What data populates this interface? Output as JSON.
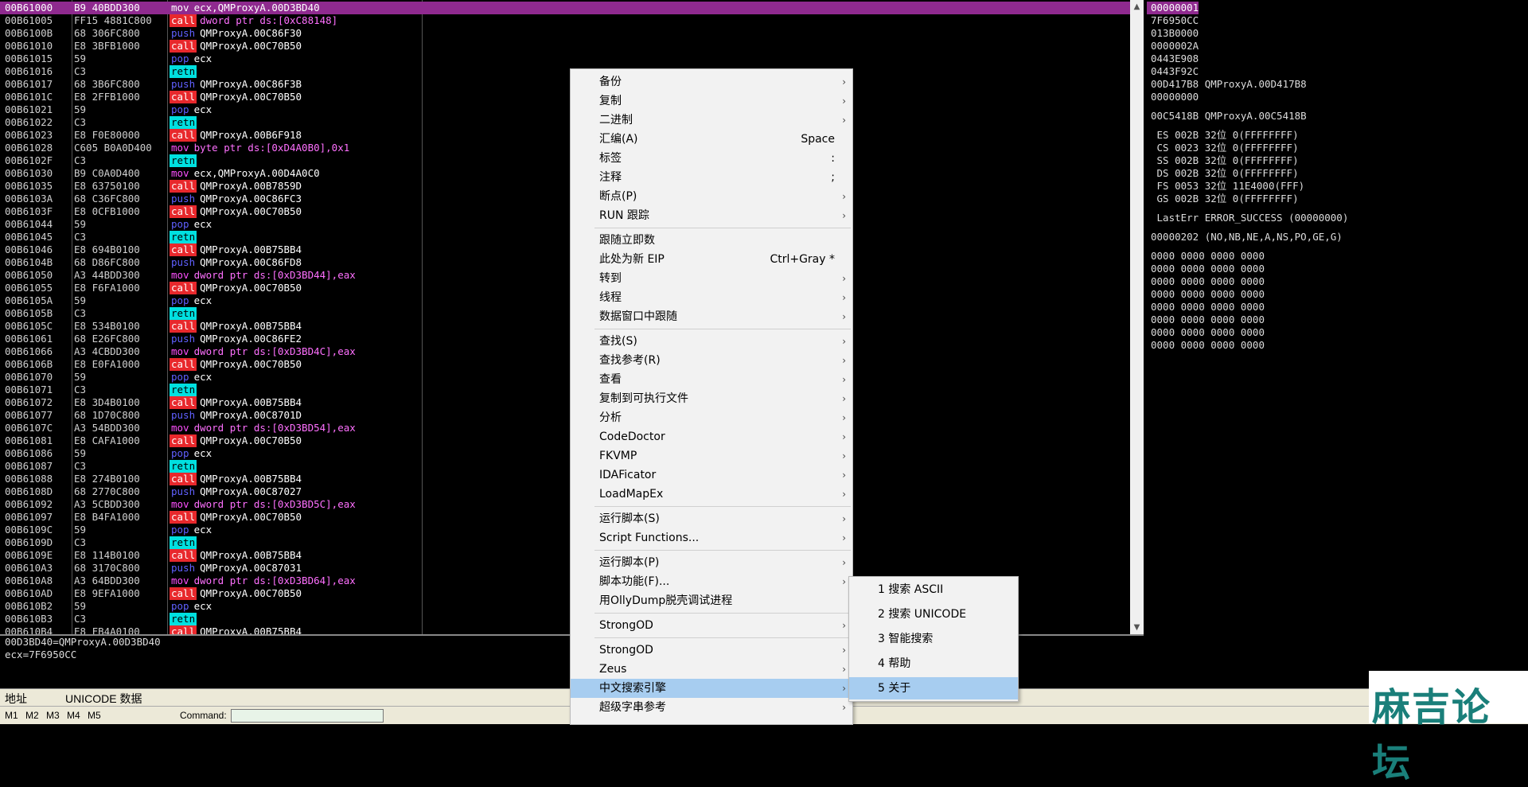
{
  "disasm": {
    "rows": [
      {
        "addr": "00B61000",
        "hex": "B9 40BDD300",
        "op": "mov",
        "args": "ecx,QMProxyA.00D3BD40",
        "sel": true
      },
      {
        "addr": "00B61005",
        "hex": "FF15 4881C800",
        "op": "call",
        "args": "dword ptr ds:[0xC88148]",
        "argstyle": "pink"
      },
      {
        "addr": "00B6100B",
        "hex": "68 306FC800",
        "op": "push",
        "args": "QMProxyA.00C86F30"
      },
      {
        "addr": "00B61010",
        "hex": "E8 3BFB1000",
        "op": "call",
        "args": "QMProxyA.00C70B50"
      },
      {
        "addr": "00B61015",
        "hex": "59",
        "op": "pop",
        "args": "ecx"
      },
      {
        "addr": "00B61016",
        "hex": "C3",
        "op": "retn",
        "args": ""
      },
      {
        "addr": "00B61017",
        "hex": "68 3B6FC800",
        "op": "push",
        "args": "QMProxyA.00C86F3B"
      },
      {
        "addr": "00B6101C",
        "hex": "E8 2FFB1000",
        "op": "call",
        "args": "QMProxyA.00C70B50"
      },
      {
        "addr": "00B61021",
        "hex": "59",
        "op": "pop",
        "args": "ecx"
      },
      {
        "addr": "00B61022",
        "hex": "C3",
        "op": "retn",
        "args": ""
      },
      {
        "addr": "00B61023",
        "hex": "E8 F0E80000",
        "op": "call",
        "args": "QMProxyA.00B6F918"
      },
      {
        "addr": "00B61028",
        "hex": "C605 B0A0D400",
        "op": "mov",
        "args": "byte ptr ds:[0xD4A0B0],0x1",
        "argstyle": "pink"
      },
      {
        "addr": "00B6102F",
        "hex": "C3",
        "op": "retn",
        "args": ""
      },
      {
        "addr": "00B61030",
        "hex": "B9 C0A0D400",
        "op": "mov",
        "args": "ecx,QMProxyA.00D4A0C0"
      },
      {
        "addr": "00B61035",
        "hex": "E8 63750100",
        "op": "call",
        "args": "QMProxyA.00B7859D"
      },
      {
        "addr": "00B6103A",
        "hex": "68 C36FC800",
        "op": "push",
        "args": "QMProxyA.00C86FC3"
      },
      {
        "addr": "00B6103F",
        "hex": "E8 0CFB1000",
        "op": "call",
        "args": "QMProxyA.00C70B50"
      },
      {
        "addr": "00B61044",
        "hex": "59",
        "op": "pop",
        "args": "ecx"
      },
      {
        "addr": "00B61045",
        "hex": "C3",
        "op": "retn",
        "args": ""
      },
      {
        "addr": "00B61046",
        "hex": "E8 694B0100",
        "op": "call",
        "args": "QMProxyA.00B75BB4"
      },
      {
        "addr": "00B6104B",
        "hex": "68 D86FC800",
        "op": "push",
        "args": "QMProxyA.00C86FD8"
      },
      {
        "addr": "00B61050",
        "hex": "A3 44BDD300",
        "op": "mov",
        "args": "dword ptr ds:[0xD3BD44],eax",
        "argstyle": "pink"
      },
      {
        "addr": "00B61055",
        "hex": "E8 F6FA1000",
        "op": "call",
        "args": "QMProxyA.00C70B50"
      },
      {
        "addr": "00B6105A",
        "hex": "59",
        "op": "pop",
        "args": "ecx"
      },
      {
        "addr": "00B6105B",
        "hex": "C3",
        "op": "retn",
        "args": ""
      },
      {
        "addr": "00B6105C",
        "hex": "E8 534B0100",
        "op": "call",
        "args": "QMProxyA.00B75BB4"
      },
      {
        "addr": "00B61061",
        "hex": "68 E26FC800",
        "op": "push",
        "args": "QMProxyA.00C86FE2"
      },
      {
        "addr": "00B61066",
        "hex": "A3 4CBDD300",
        "op": "mov",
        "args": "dword ptr ds:[0xD3BD4C],eax",
        "argstyle": "pink"
      },
      {
        "addr": "00B6106B",
        "hex": "E8 E0FA1000",
        "op": "call",
        "args": "QMProxyA.00C70B50"
      },
      {
        "addr": "00B61070",
        "hex": "59",
        "op": "pop",
        "args": "ecx"
      },
      {
        "addr": "00B61071",
        "hex": "C3",
        "op": "retn",
        "args": ""
      },
      {
        "addr": "00B61072",
        "hex": "E8 3D4B0100",
        "op": "call",
        "args": "QMProxyA.00B75BB4"
      },
      {
        "addr": "00B61077",
        "hex": "68 1D70C800",
        "op": "push",
        "args": "QMProxyA.00C8701D"
      },
      {
        "addr": "00B6107C",
        "hex": "A3 54BDD300",
        "op": "mov",
        "args": "dword ptr ds:[0xD3BD54],eax",
        "argstyle": "pink"
      },
      {
        "addr": "00B61081",
        "hex": "E8 CAFA1000",
        "op": "call",
        "args": "QMProxyA.00C70B50"
      },
      {
        "addr": "00B61086",
        "hex": "59",
        "op": "pop",
        "args": "ecx"
      },
      {
        "addr": "00B61087",
        "hex": "C3",
        "op": "retn",
        "args": ""
      },
      {
        "addr": "00B61088",
        "hex": "E8 274B0100",
        "op": "call",
        "args": "QMProxyA.00B75BB4"
      },
      {
        "addr": "00B6108D",
        "hex": "68 2770C800",
        "op": "push",
        "args": "QMProxyA.00C87027"
      },
      {
        "addr": "00B61092",
        "hex": "A3 5CBDD300",
        "op": "mov",
        "args": "dword ptr ds:[0xD3BD5C],eax",
        "argstyle": "pink"
      },
      {
        "addr": "00B61097",
        "hex": "E8 B4FA1000",
        "op": "call",
        "args": "QMProxyA.00C70B50"
      },
      {
        "addr": "00B6109C",
        "hex": "59",
        "op": "pop",
        "args": "ecx"
      },
      {
        "addr": "00B6109D",
        "hex": "C3",
        "op": "retn",
        "args": ""
      },
      {
        "addr": "00B6109E",
        "hex": "E8 114B0100",
        "op": "call",
        "args": "QMProxyA.00B75BB4"
      },
      {
        "addr": "00B610A3",
        "hex": "68 3170C800",
        "op": "push",
        "args": "QMProxyA.00C87031"
      },
      {
        "addr": "00B610A8",
        "hex": "A3 64BDD300",
        "op": "mov",
        "args": "dword ptr ds:[0xD3BD64],eax",
        "argstyle": "pink"
      },
      {
        "addr": "00B610AD",
        "hex": "E8 9EFA1000",
        "op": "call",
        "args": "QMProxyA.00C70B50"
      },
      {
        "addr": "00B610B2",
        "hex": "59",
        "op": "pop",
        "args": "ecx"
      },
      {
        "addr": "00B610B3",
        "hex": "C3",
        "op": "retn",
        "args": ""
      },
      {
        "addr": "00B610B4",
        "hex": "E8 FB4A0100",
        "op": "call",
        "args": "QMProxyA.00B75BB4"
      }
    ]
  },
  "info": {
    "line1": "00D3BD40=QMProxyA.00D3BD40",
    "line2": "ecx=7F6950CC"
  },
  "registers": [
    {
      "text": "00000001",
      "sel": true
    },
    {
      "text": "7F6950CC"
    },
    {
      "text": "013B0000"
    },
    {
      "text": "0000002A"
    },
    {
      "text": "0443E908"
    },
    {
      "text": "0443F92C"
    },
    {
      "text": "00D417B8 QMProxyA.00D417B8"
    },
    {
      "text": "00000000"
    },
    {
      "text": ""
    },
    {
      "text": "00C5418B QMProxyA.00C5418B"
    },
    {
      "text": ""
    },
    {
      "text": " ES 002B 32位 0(FFFFFFFF)"
    },
    {
      "text": " CS 0023 32位 0(FFFFFFFF)"
    },
    {
      "text": " SS 002B 32位 0(FFFFFFFF)"
    },
    {
      "text": " DS 002B 32位 0(FFFFFFFF)"
    },
    {
      "text": " FS 0053 32位 11E4000(FFF)"
    },
    {
      "text": " GS 002B 32位 0(FFFFFFFF)"
    },
    {
      "text": ""
    },
    {
      "text": " LastErr ERROR_SUCCESS (00000000)"
    },
    {
      "text": ""
    },
    {
      "text": "00000202 (NO,NB,NE,A,NS,PO,GE,G)"
    },
    {
      "text": ""
    },
    {
      "text": "0000 0000 0000 0000"
    },
    {
      "text": "0000 0000 0000 0000"
    },
    {
      "text": "0000 0000 0000 0000"
    },
    {
      "text": "0000 0000 0000 0000"
    },
    {
      "text": "0000 0000 0000 0000"
    },
    {
      "text": "0000 0000 0000 0000"
    },
    {
      "text": "0000 0000 0000 0000"
    },
    {
      "text": "0000 0000 0000 0000"
    }
  ],
  "dump": {
    "col_addr": "地址",
    "col_data": "UNICODE 数据"
  },
  "statusbar": {
    "tabs": [
      "M1",
      "M2",
      "M3",
      "M4",
      "M5"
    ],
    "command_label": "Command:"
  },
  "context_menu": {
    "items": [
      {
        "label": "备份",
        "submenu": true
      },
      {
        "label": "复制",
        "submenu": true
      },
      {
        "label": "二进制",
        "submenu": true
      },
      {
        "label": "汇编(A)",
        "shortcut": "Space"
      },
      {
        "label": "标签",
        "shortcut": ":"
      },
      {
        "label": "注释",
        "shortcut": ";"
      },
      {
        "label": "断点(P)",
        "submenu": true
      },
      {
        "label": "RUN 跟踪",
        "submenu": true
      },
      {
        "sep": true
      },
      {
        "label": "跟随立即数"
      },
      {
        "label": "此处为新 EIP",
        "shortcut": "Ctrl+Gray *"
      },
      {
        "label": "转到",
        "submenu": true
      },
      {
        "label": "线程",
        "submenu": true
      },
      {
        "label": "数据窗口中跟随",
        "submenu": true
      },
      {
        "sep": true
      },
      {
        "label": "查找(S)",
        "submenu": true
      },
      {
        "label": "查找参考(R)",
        "submenu": true
      },
      {
        "label": "查看",
        "submenu": true
      },
      {
        "label": "复制到可执行文件",
        "submenu": true
      },
      {
        "label": "分析",
        "submenu": true
      },
      {
        "label": "CodeDoctor",
        "submenu": true
      },
      {
        "label": "FKVMP",
        "submenu": true
      },
      {
        "label": "IDAFicator",
        "submenu": true
      },
      {
        "label": "LoadMapEx",
        "submenu": true
      },
      {
        "sep": true
      },
      {
        "label": "运行脚本(S)",
        "submenu": true
      },
      {
        "label": "Script Functions...",
        "submenu": true
      },
      {
        "sep": true
      },
      {
        "label": "运行脚本(P)",
        "submenu": true
      },
      {
        "label": "脚本功能(F)...",
        "submenu": true
      },
      {
        "label": "用OllyDump脱壳调试进程"
      },
      {
        "sep": true
      },
      {
        "label": "StrongOD",
        "submenu": true
      },
      {
        "sep": true
      },
      {
        "label": "StrongOD",
        "submenu": true
      },
      {
        "label": "Zeus",
        "submenu": true
      },
      {
        "label": "中文搜索引擎",
        "submenu": true,
        "highlight": true
      },
      {
        "label": "超级字串参考",
        "submenu": true
      }
    ]
  },
  "submenu": {
    "items": [
      {
        "label": "1 搜索 ASCII"
      },
      {
        "label": "2 搜索 UNICODE"
      },
      {
        "label": "3 智能搜索"
      },
      {
        "label": "4 帮助"
      },
      {
        "label": "5 关于",
        "highlight": true
      }
    ]
  },
  "logo": {
    "text": "麻吉论坛"
  }
}
